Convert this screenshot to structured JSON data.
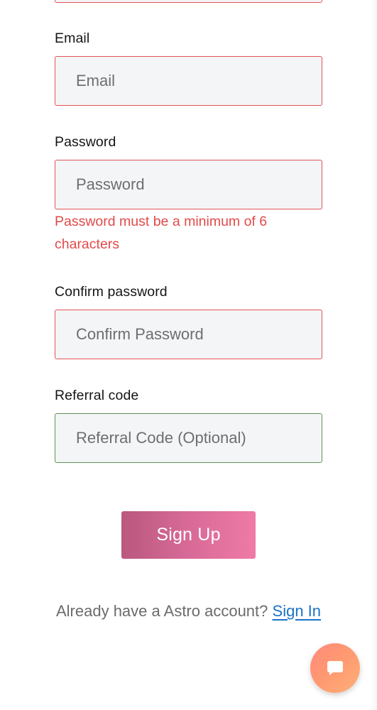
{
  "form": {
    "email": {
      "label": "Email",
      "placeholder": "Email"
    },
    "password": {
      "label": "Password",
      "placeholder": "Password",
      "error": "Password must be a minimum of 6 characters"
    },
    "confirm_password": {
      "label": "Confirm password",
      "placeholder": "Confirm Password"
    },
    "referral": {
      "label": "Referral code",
      "placeholder": "Referral Code (Optional)"
    },
    "submit_label": "Sign Up"
  },
  "footer": {
    "prompt": "Already have a Astro account? ",
    "sign_in_link": "Sign In"
  },
  "chat": {
    "icon": "chat-bubble-icon"
  },
  "colors": {
    "error": "#e14a4a",
    "valid": "#5f9455",
    "link": "#1a73c8",
    "button_gradient_start": "#b9587e",
    "button_gradient_end": "#ef7aa6",
    "fab_gradient_start": "#ff8a7c",
    "fab_gradient_end": "#ffb07a"
  }
}
